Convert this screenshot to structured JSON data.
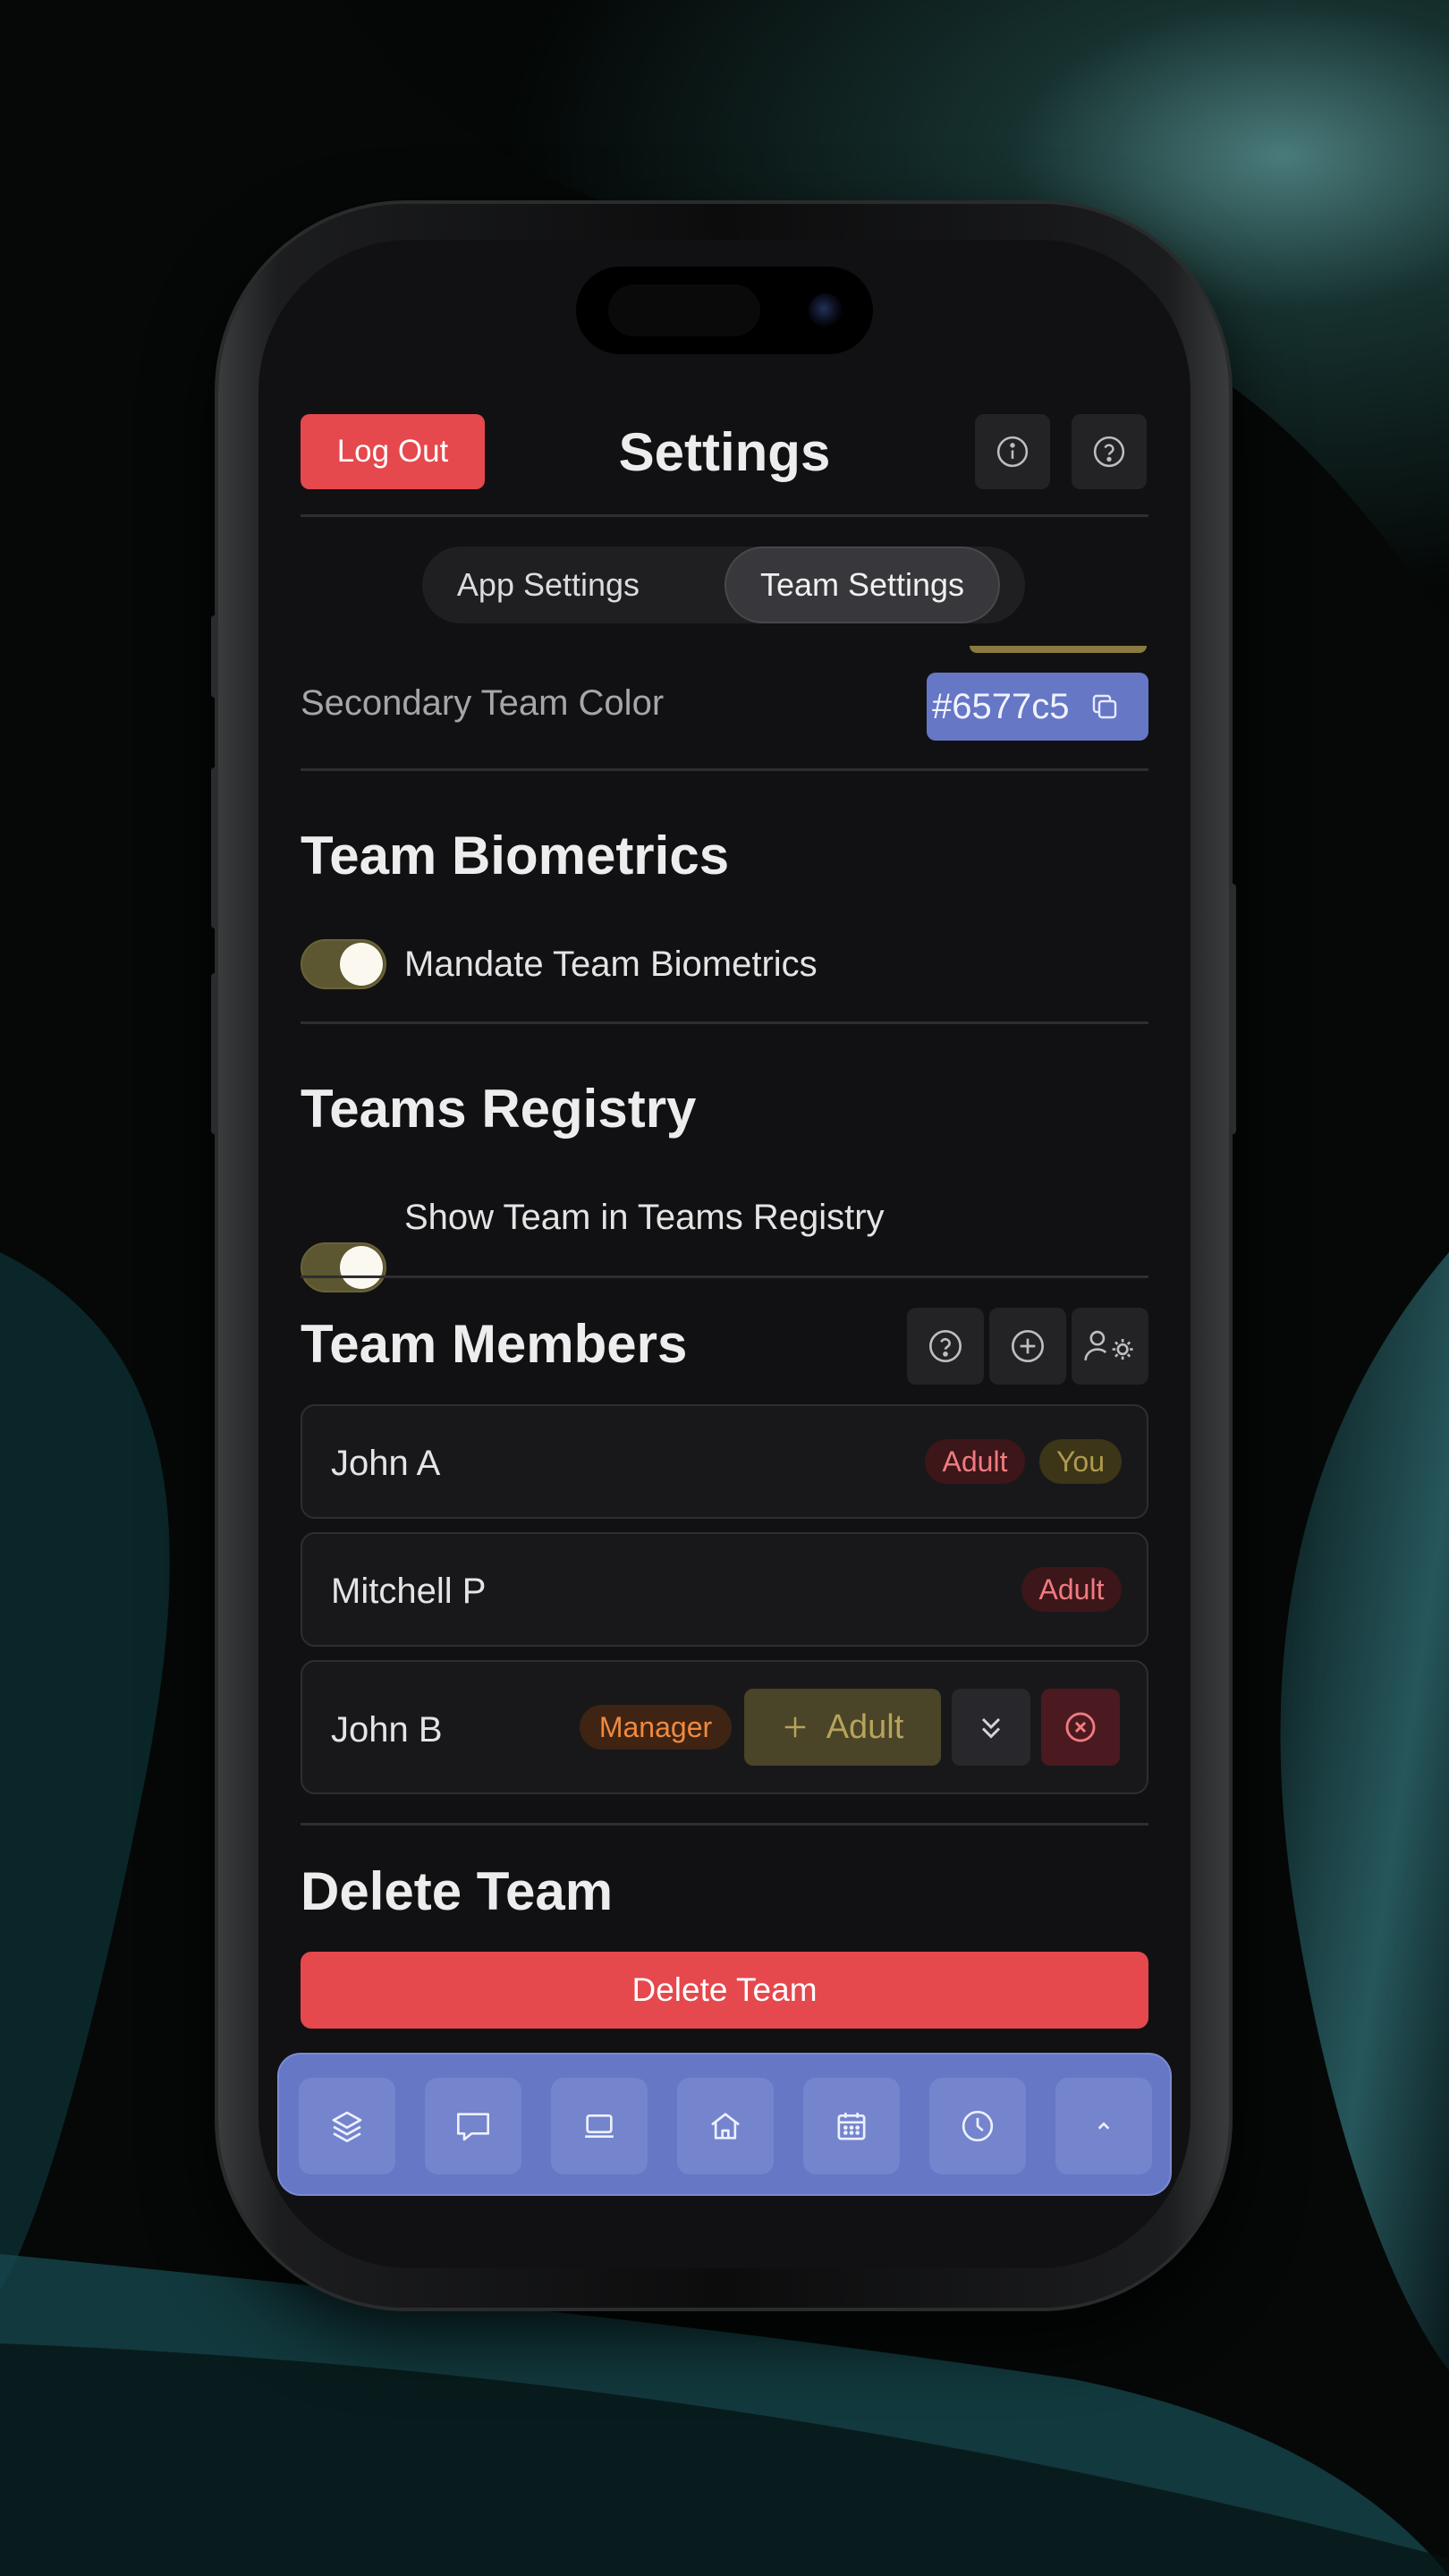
{
  "header": {
    "logout_label": "Log Out",
    "title": "Settings",
    "info_icon": "info-icon",
    "help_icon": "help-icon"
  },
  "segmented": {
    "tabs": [
      {
        "label": "App Settings",
        "active": false
      },
      {
        "label": "Team Settings",
        "active": true
      }
    ]
  },
  "secondary_color": {
    "label": "Secondary Team Color",
    "value": "#6577c5",
    "copy_icon": "copy-icon"
  },
  "biometrics": {
    "heading": "Team Biometrics",
    "toggle_label": "Mandate Team Biometrics",
    "enabled": true
  },
  "registry": {
    "heading": "Teams Registry",
    "toggle_label": "Show Team in Teams Registry",
    "enabled": true
  },
  "members": {
    "heading": "Team Members",
    "action_icons": [
      "help-icon",
      "plus-circle-icon",
      "users-gear-icon"
    ],
    "list": [
      {
        "name": "John A",
        "badges": [
          "Adult",
          "You"
        ]
      },
      {
        "name": "Mitchell P",
        "badges": [
          "Adult"
        ]
      },
      {
        "name": "John B",
        "badges": [
          "Manager"
        ],
        "add_label": "Adult"
      }
    ]
  },
  "delete": {
    "heading": "Delete Team",
    "button_label": "Delete Team"
  },
  "tabbar": {
    "icons": [
      "layers-icon",
      "chat-icon",
      "laptop-icon",
      "home-icon",
      "calendar-icon",
      "clock-icon",
      "chevron-up-icon"
    ]
  },
  "colors": {
    "accent": "#6577c5",
    "danger": "#e5484d",
    "toggle_on": "#5c5631",
    "background": "#111113"
  }
}
